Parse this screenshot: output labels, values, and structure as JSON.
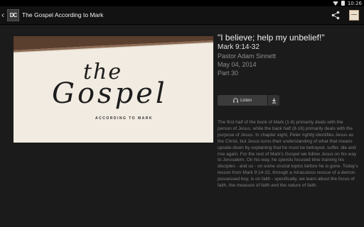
{
  "status_bar": {
    "time": "10:26"
  },
  "app_bar": {
    "back_glyph": "‹",
    "logo_text": "DC",
    "title": "The Gospel According to Mark",
    "share_icon": "share-icon"
  },
  "artwork": {
    "line1": "the",
    "line2": "Gospel",
    "subtitle": "ACCORDING  TO  MARK"
  },
  "sermon": {
    "quote": "\"I believe; help my unbelief!\"",
    "reference": "Mark 9:14-32",
    "pastor": "Pastor Adam Sinnett",
    "date": "May 04, 2014",
    "part": "Part 30"
  },
  "actions": {
    "listen_label": "Listen",
    "download_icon": "download-icon"
  },
  "description": "The first half of the book of Mark (1-8) primarily deals with the person of Jesus, while the back half (8-16) primarily deals with the purpose of Jesus. In chapter eight, Peter rightly identifies Jesus as the Christ, but Jesus turns their understanding of what that means upside-down by explaining that he must be betrayed, suffer, die and rise again. For the rest of Mark's Gospel we follow Jesus on his way to Jerusalem. On his way, he spends focused time training his disciples - and us - on some crucial topics before he is gone. Today's lesson from Mark 9:14-32, through a miraculous rescue of a demon possessed boy, is on faith - specifically, we learn about the focus of faith, the measure of faith and the nature of faith."
}
